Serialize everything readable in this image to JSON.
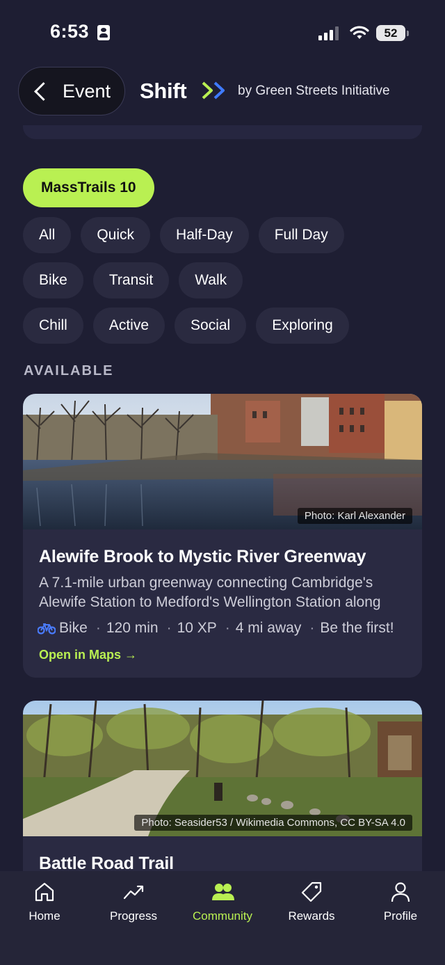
{
  "status_bar": {
    "time": "6:53",
    "battery": "52"
  },
  "header": {
    "back_label": "Event",
    "brand": "Shift",
    "brand_by": "by Green Streets Initiative",
    "brand_colors": {
      "arrow_green": "#b9f052",
      "arrow_blue": "#3f7bff"
    }
  },
  "featured_filter": "MassTrails 10",
  "filters": {
    "duration": [
      "All",
      "Quick",
      "Half-Day",
      "Full Day"
    ],
    "mode": [
      "Bike",
      "Transit",
      "Walk"
    ],
    "vibe": [
      "Chill",
      "Active",
      "Social",
      "Exploring"
    ]
  },
  "section_label": "AVAILABLE",
  "cards": [
    {
      "photo_credit": "Photo: Karl Alexander",
      "title": "Alewife Brook to Mystic River Greenway",
      "desc_line1": "A 7.1-mile urban greenway connecting Cambridge's",
      "desc_line2": "Alewife Station to Medford's Wellington Station along",
      "mode_icon": "bike-icon",
      "mode": "Bike",
      "duration": "120 min",
      "xp": "10 XP",
      "distance": "4 mi away",
      "social": "Be the first!",
      "link": "Open in Maps →"
    },
    {
      "photo_credit": "Photo: Seasider53 / Wikimedia Commons, CC BY-SA 4.0",
      "title": "Battle Road Trail"
    }
  ],
  "tabs": [
    {
      "label": "Home",
      "icon": "home-icon"
    },
    {
      "label": "Progress",
      "icon": "trend-up-icon"
    },
    {
      "label": "Community",
      "icon": "people-icon"
    },
    {
      "label": "Rewards",
      "icon": "tag-icon"
    },
    {
      "label": "Profile",
      "icon": "person-icon"
    }
  ],
  "active_tab": "Community",
  "colors": {
    "accent": "#b9f052",
    "background": "#1e1e33",
    "card": "#2a2a42"
  }
}
